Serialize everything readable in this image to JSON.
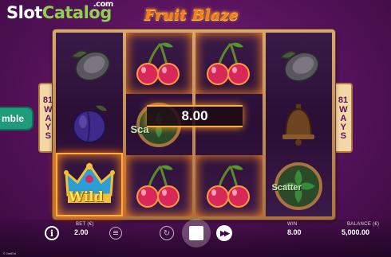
{
  "watermark": {
    "part_a": "Slot",
    "part_b": "Catalog",
    "dot": ".com"
  },
  "game": {
    "logo": "Fruit Blaze"
  },
  "ways": {
    "count": "81",
    "label": "WAYS"
  },
  "gamble": {
    "label": "mble"
  },
  "win_display": {
    "amount": "8.00"
  },
  "reels": [
    [
      "lemon",
      "plum",
      "wild-crown"
    ],
    [
      "cherry",
      "scatter-partial",
      "cherry"
    ],
    [
      "cherry",
      "blank-glow",
      "cherry"
    ],
    [
      "lemon",
      "bell",
      "scatter"
    ]
  ],
  "symbols": {
    "wild_text": "Wild",
    "scatter_text": "Scatter",
    "scatter_partial_text": "Sca"
  },
  "hud": {
    "info_icon": "i",
    "bet_label": "BET (€)",
    "bet_value": "2.00",
    "win_label": "WIN",
    "win_value": "8.00",
    "balance_label": "BALANCE (€)",
    "balance_value": "5,000.00",
    "provider": "© NetEnt",
    "auto_icon": "↻",
    "ff_icon": "▶▶"
  },
  "colors": {
    "accent": "#ffb03b",
    "background": "#5b145f",
    "gamble": "#1f9a7b"
  }
}
